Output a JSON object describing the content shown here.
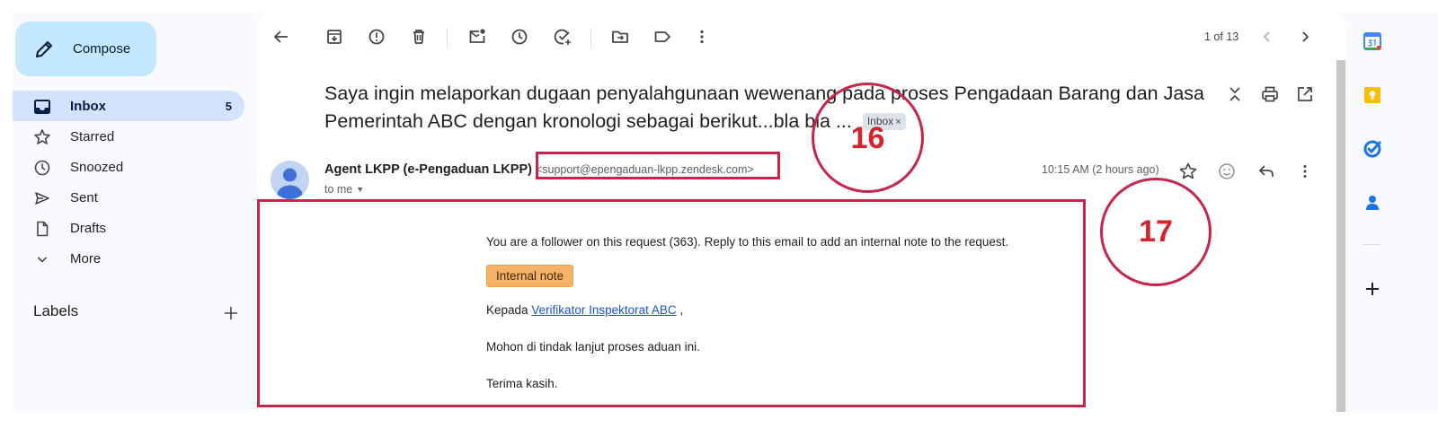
{
  "sidebar": {
    "compose_label": "Compose",
    "items": [
      {
        "label": "Inbox",
        "count": "5",
        "icon": "inbox-icon"
      },
      {
        "label": "Starred",
        "icon": "star-icon"
      },
      {
        "label": "Snoozed",
        "icon": "clock-icon"
      },
      {
        "label": "Sent",
        "icon": "send-icon"
      },
      {
        "label": "Drafts",
        "icon": "file-icon"
      },
      {
        "label": "More",
        "icon": "chevron-down-icon"
      }
    ],
    "labels_title": "Labels"
  },
  "toolbar": {
    "pager": "1 of 13"
  },
  "email": {
    "subject": "Saya ingin melaporkan dugaan penyalahgunaan wewenang pada proses Pengadaan Barang dan Jasa Pemerintah ABC dengan kronologi sebagai berikut...bla bla ...",
    "label_chip": "Inbox",
    "chip_close": "×",
    "sender_name": "Agent LKPP (e-Pengaduan LKPP)",
    "sender_email": "<support@epengaduan-lkpp.zendesk.com>",
    "recipient": "to me",
    "time": "10:15 AM (2 hours ago)",
    "body": {
      "line1": "You are a follower on this request (363). Reply to this email to add an internal note to the request.",
      "badge": "Internal note",
      "greeting_prefix": "Kepada ",
      "greeting_link": "Verifikator Inspektorat ABC",
      "greeting_suffix": " ,",
      "line3": "Mohon di tindak lanjut proses aduan ini.",
      "line4": "Terima kasih."
    }
  },
  "annotations": {
    "first": "16",
    "second": "17"
  },
  "colors": {
    "accent": "#c2e7ff",
    "active_nav": "#d3e3fd",
    "annotation": "#c8254c",
    "badge": "#f6b266",
    "link": "#1a57c9"
  }
}
